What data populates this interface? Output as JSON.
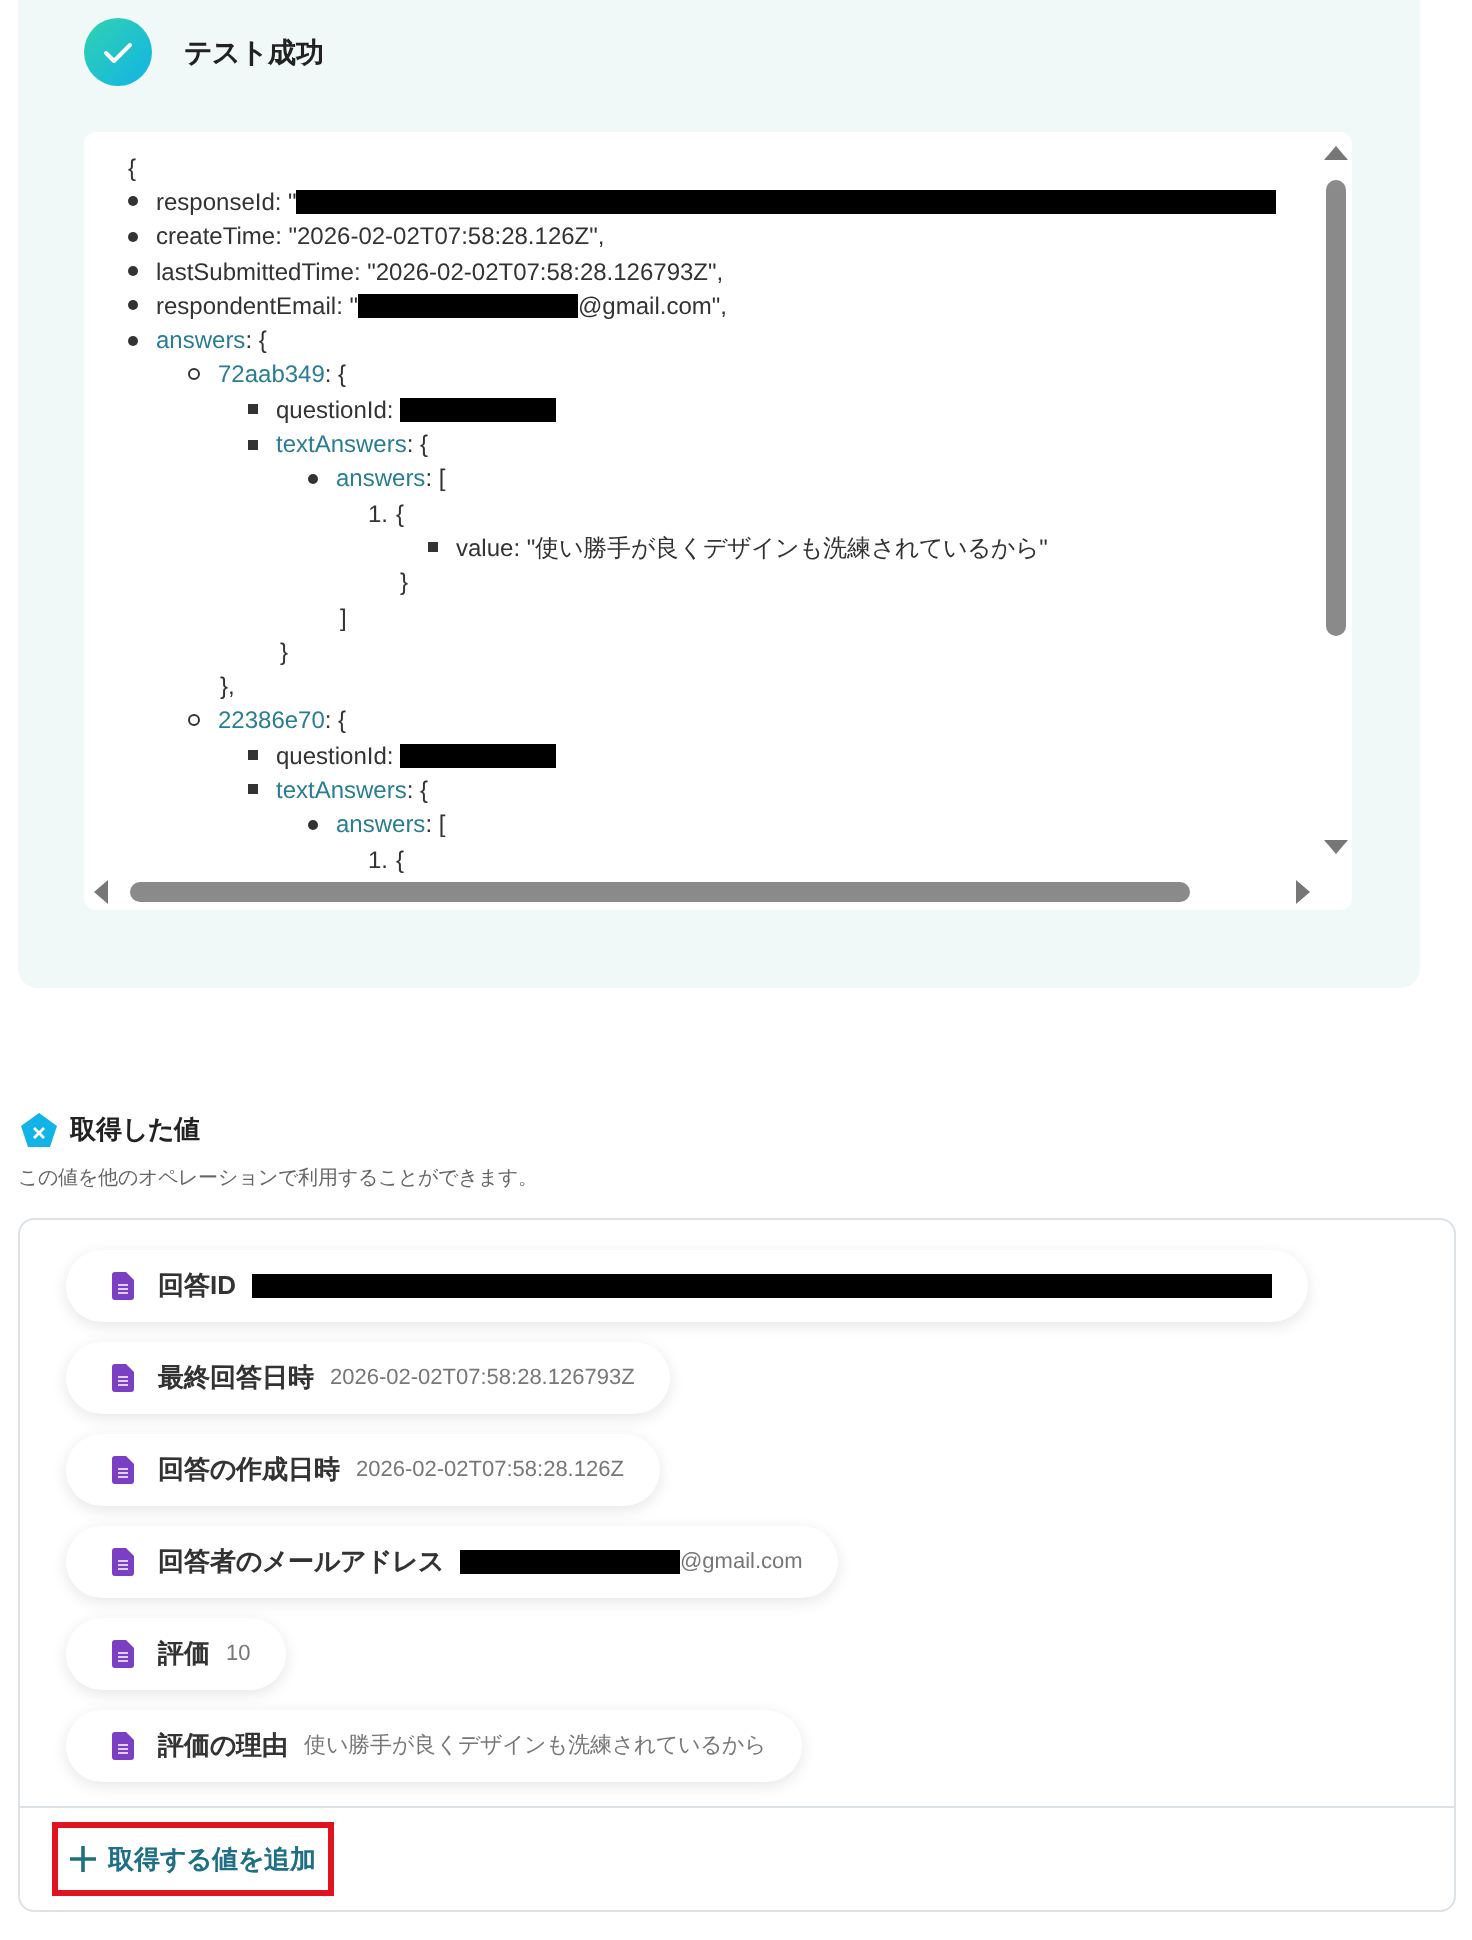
{
  "test_result": {
    "title": "テスト成功",
    "passed": true,
    "tree": {
      "open": "{",
      "items": [
        {
          "key": "responseId",
          "link": false,
          "value": ": \"",
          "redacted": true
        },
        {
          "key": "createTime",
          "link": false,
          "value": ": \"2026-02-02T07:58:28.126Z\","
        },
        {
          "key": "lastSubmittedTime",
          "link": false,
          "value": ": \"2026-02-02T07:58:28.126793Z\","
        },
        {
          "key": "respondentEmail",
          "link": false,
          "value": ": \"",
          "redacted": true,
          "after": "@gmail.com\","
        },
        {
          "key": "answers",
          "link": true,
          "value": ": {",
          "children": [
            {
              "key": "72aab349",
              "link": true,
              "value": ": {",
              "children": [
                {
                  "key": "questionId",
                  "link": false,
                  "value": ": ",
                  "redacted": true
                },
                {
                  "key": "textAnswers",
                  "link": true,
                  "value": ": {",
                  "children": [
                    {
                      "key": "answers",
                      "link": true,
                      "value": ": [",
                      "children": [
                        {
                          "marker": "1.",
                          "value": "{",
                          "children": [
                            {
                              "key": "value",
                              "link": false,
                              "value": ": \"使い勝手が良くデザインも洗練されているから\""
                            }
                          ],
                          "close": "}"
                        }
                      ],
                      "close": "]"
                    }
                  ],
                  "close": "}"
                }
              ],
              "close": "},"
            },
            {
              "key": "22386e70",
              "link": true,
              "value": ": {",
              "children": [
                {
                  "key": "questionId",
                  "link": false,
                  "value": ": ",
                  "redacted": true
                },
                {
                  "key": "textAnswers",
                  "link": true,
                  "value": ": {",
                  "children": [
                    {
                      "key": "answers",
                      "link": true,
                      "value": ": [",
                      "children": [
                        {
                          "marker": "1.",
                          "value": "{"
                        }
                      ]
                    }
                  ]
                }
              ]
            }
          ]
        }
      ]
    }
  },
  "values": {
    "title": "取得した値",
    "description": "この値を他のオペレーションで利用することができます。",
    "items": [
      {
        "label": "回答ID",
        "redacted": true
      },
      {
        "label": "最終回答日時",
        "value": "2026-02-02T07:58:28.126793Z"
      },
      {
        "label": "回答の作成日時",
        "value": "2026-02-02T07:58:28.126Z"
      },
      {
        "label": "回答者のメールアドレス",
        "redacted": true,
        "after": "@gmail.com"
      },
      {
        "label": "評価",
        "value": "10"
      },
      {
        "label": "評価の理由",
        "value": "使い勝手が良くデザインも洗練されているから"
      }
    ],
    "add_button": "取得する値を追加"
  }
}
